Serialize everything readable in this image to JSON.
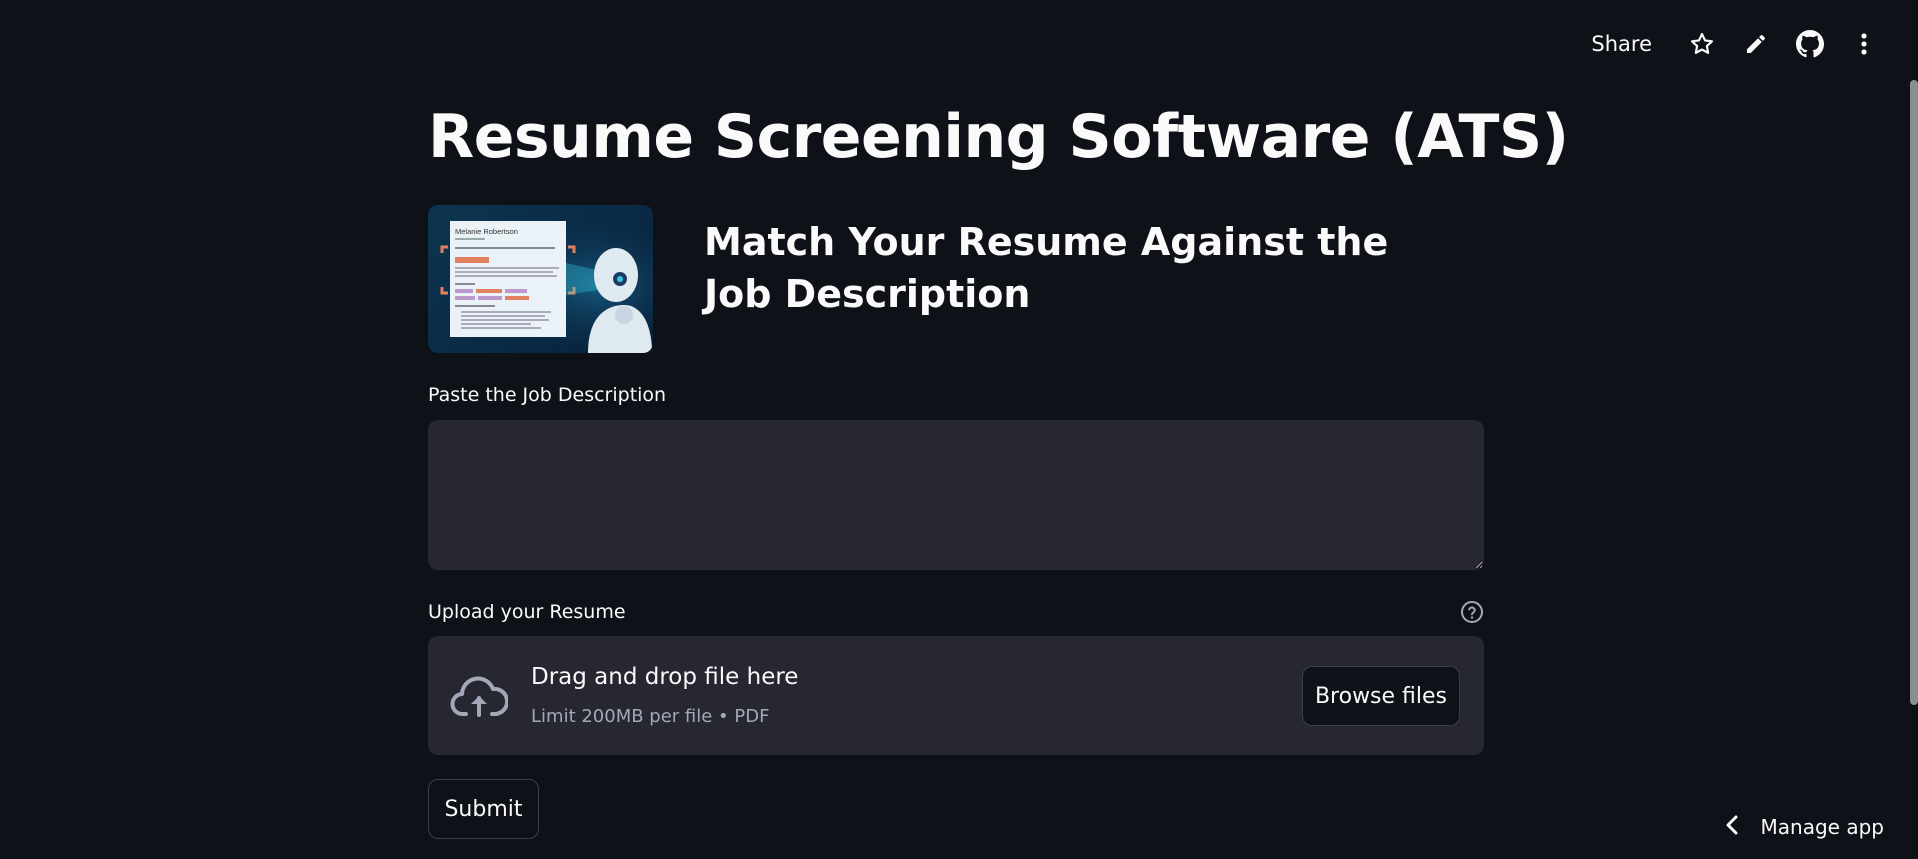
{
  "toolbar": {
    "share_label": "Share",
    "icons": [
      "star-icon",
      "pencil-icon",
      "github-icon",
      "kebab-menu-icon"
    ]
  },
  "main": {
    "title": "Resume Screening Software (ATS)",
    "subtitle": "Match Your Resume Against the Job Description",
    "hero_image": {
      "resume_name": "Melanie Robertson",
      "icon": "resume-robot-illustration"
    }
  },
  "job_description": {
    "label": "Paste the Job Description",
    "value": "",
    "placeholder": ""
  },
  "upload": {
    "label": "Upload your Resume",
    "dropzone_title": "Drag and drop file here",
    "dropzone_limit": "Limit 200MB per file • PDF",
    "browse_label": "Browse files",
    "icon": "cloud-upload-icon",
    "help_icon": "help-icon"
  },
  "submit_label": "Submit",
  "manage_app": {
    "label": "Manage app",
    "icon": "chevron-left-icon"
  },
  "colors": {
    "background": "#0e1117",
    "surface": "#262730",
    "text": "#fafafa",
    "muted_text": "#a3a8b8",
    "border": "#3c3f4a"
  }
}
